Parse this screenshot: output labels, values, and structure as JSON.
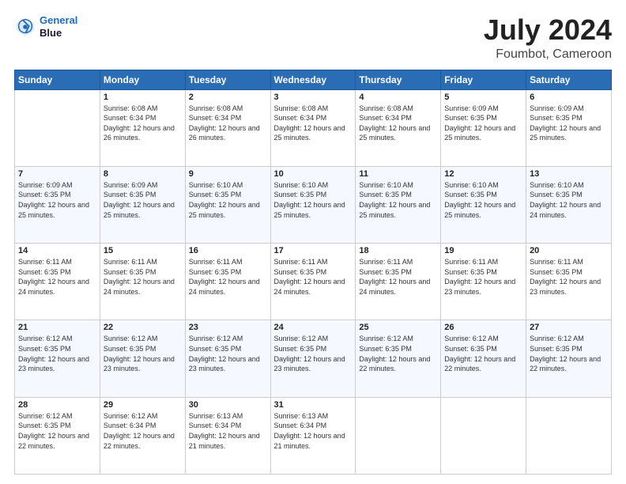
{
  "header": {
    "logo_line1": "General",
    "logo_line2": "Blue",
    "title": "July 2024",
    "subtitle": "Foumbot, Cameroon"
  },
  "days_of_week": [
    "Sunday",
    "Monday",
    "Tuesday",
    "Wednesday",
    "Thursday",
    "Friday",
    "Saturday"
  ],
  "weeks": [
    [
      {
        "day": "",
        "sunrise": "",
        "sunset": "",
        "daylight": ""
      },
      {
        "day": "1",
        "sunrise": "Sunrise: 6:08 AM",
        "sunset": "Sunset: 6:34 PM",
        "daylight": "Daylight: 12 hours and 26 minutes."
      },
      {
        "day": "2",
        "sunrise": "Sunrise: 6:08 AM",
        "sunset": "Sunset: 6:34 PM",
        "daylight": "Daylight: 12 hours and 26 minutes."
      },
      {
        "day": "3",
        "sunrise": "Sunrise: 6:08 AM",
        "sunset": "Sunset: 6:34 PM",
        "daylight": "Daylight: 12 hours and 25 minutes."
      },
      {
        "day": "4",
        "sunrise": "Sunrise: 6:08 AM",
        "sunset": "Sunset: 6:34 PM",
        "daylight": "Daylight: 12 hours and 25 minutes."
      },
      {
        "day": "5",
        "sunrise": "Sunrise: 6:09 AM",
        "sunset": "Sunset: 6:35 PM",
        "daylight": "Daylight: 12 hours and 25 minutes."
      },
      {
        "day": "6",
        "sunrise": "Sunrise: 6:09 AM",
        "sunset": "Sunset: 6:35 PM",
        "daylight": "Daylight: 12 hours and 25 minutes."
      }
    ],
    [
      {
        "day": "7",
        "sunrise": "Sunrise: 6:09 AM",
        "sunset": "Sunset: 6:35 PM",
        "daylight": "Daylight: 12 hours and 25 minutes."
      },
      {
        "day": "8",
        "sunrise": "Sunrise: 6:09 AM",
        "sunset": "Sunset: 6:35 PM",
        "daylight": "Daylight: 12 hours and 25 minutes."
      },
      {
        "day": "9",
        "sunrise": "Sunrise: 6:10 AM",
        "sunset": "Sunset: 6:35 PM",
        "daylight": "Daylight: 12 hours and 25 minutes."
      },
      {
        "day": "10",
        "sunrise": "Sunrise: 6:10 AM",
        "sunset": "Sunset: 6:35 PM",
        "daylight": "Daylight: 12 hours and 25 minutes."
      },
      {
        "day": "11",
        "sunrise": "Sunrise: 6:10 AM",
        "sunset": "Sunset: 6:35 PM",
        "daylight": "Daylight: 12 hours and 25 minutes."
      },
      {
        "day": "12",
        "sunrise": "Sunrise: 6:10 AM",
        "sunset": "Sunset: 6:35 PM",
        "daylight": "Daylight: 12 hours and 25 minutes."
      },
      {
        "day": "13",
        "sunrise": "Sunrise: 6:10 AM",
        "sunset": "Sunset: 6:35 PM",
        "daylight": "Daylight: 12 hours and 24 minutes."
      }
    ],
    [
      {
        "day": "14",
        "sunrise": "Sunrise: 6:11 AM",
        "sunset": "Sunset: 6:35 PM",
        "daylight": "Daylight: 12 hours and 24 minutes."
      },
      {
        "day": "15",
        "sunrise": "Sunrise: 6:11 AM",
        "sunset": "Sunset: 6:35 PM",
        "daylight": "Daylight: 12 hours and 24 minutes."
      },
      {
        "day": "16",
        "sunrise": "Sunrise: 6:11 AM",
        "sunset": "Sunset: 6:35 PM",
        "daylight": "Daylight: 12 hours and 24 minutes."
      },
      {
        "day": "17",
        "sunrise": "Sunrise: 6:11 AM",
        "sunset": "Sunset: 6:35 PM",
        "daylight": "Daylight: 12 hours and 24 minutes."
      },
      {
        "day": "18",
        "sunrise": "Sunrise: 6:11 AM",
        "sunset": "Sunset: 6:35 PM",
        "daylight": "Daylight: 12 hours and 24 minutes."
      },
      {
        "day": "19",
        "sunrise": "Sunrise: 6:11 AM",
        "sunset": "Sunset: 6:35 PM",
        "daylight": "Daylight: 12 hours and 23 minutes."
      },
      {
        "day": "20",
        "sunrise": "Sunrise: 6:11 AM",
        "sunset": "Sunset: 6:35 PM",
        "daylight": "Daylight: 12 hours and 23 minutes."
      }
    ],
    [
      {
        "day": "21",
        "sunrise": "Sunrise: 6:12 AM",
        "sunset": "Sunset: 6:35 PM",
        "daylight": "Daylight: 12 hours and 23 minutes."
      },
      {
        "day": "22",
        "sunrise": "Sunrise: 6:12 AM",
        "sunset": "Sunset: 6:35 PM",
        "daylight": "Daylight: 12 hours and 23 minutes."
      },
      {
        "day": "23",
        "sunrise": "Sunrise: 6:12 AM",
        "sunset": "Sunset: 6:35 PM",
        "daylight": "Daylight: 12 hours and 23 minutes."
      },
      {
        "day": "24",
        "sunrise": "Sunrise: 6:12 AM",
        "sunset": "Sunset: 6:35 PM",
        "daylight": "Daylight: 12 hours and 23 minutes."
      },
      {
        "day": "25",
        "sunrise": "Sunrise: 6:12 AM",
        "sunset": "Sunset: 6:35 PM",
        "daylight": "Daylight: 12 hours and 22 minutes."
      },
      {
        "day": "26",
        "sunrise": "Sunrise: 6:12 AM",
        "sunset": "Sunset: 6:35 PM",
        "daylight": "Daylight: 12 hours and 22 minutes."
      },
      {
        "day": "27",
        "sunrise": "Sunrise: 6:12 AM",
        "sunset": "Sunset: 6:35 PM",
        "daylight": "Daylight: 12 hours and 22 minutes."
      }
    ],
    [
      {
        "day": "28",
        "sunrise": "Sunrise: 6:12 AM",
        "sunset": "Sunset: 6:35 PM",
        "daylight": "Daylight: 12 hours and 22 minutes."
      },
      {
        "day": "29",
        "sunrise": "Sunrise: 6:12 AM",
        "sunset": "Sunset: 6:34 PM",
        "daylight": "Daylight: 12 hours and 22 minutes."
      },
      {
        "day": "30",
        "sunrise": "Sunrise: 6:13 AM",
        "sunset": "Sunset: 6:34 PM",
        "daylight": "Daylight: 12 hours and 21 minutes."
      },
      {
        "day": "31",
        "sunrise": "Sunrise: 6:13 AM",
        "sunset": "Sunset: 6:34 PM",
        "daylight": "Daylight: 12 hours and 21 minutes."
      },
      {
        "day": "",
        "sunrise": "",
        "sunset": "",
        "daylight": ""
      },
      {
        "day": "",
        "sunrise": "",
        "sunset": "",
        "daylight": ""
      },
      {
        "day": "",
        "sunrise": "",
        "sunset": "",
        "daylight": ""
      }
    ]
  ]
}
